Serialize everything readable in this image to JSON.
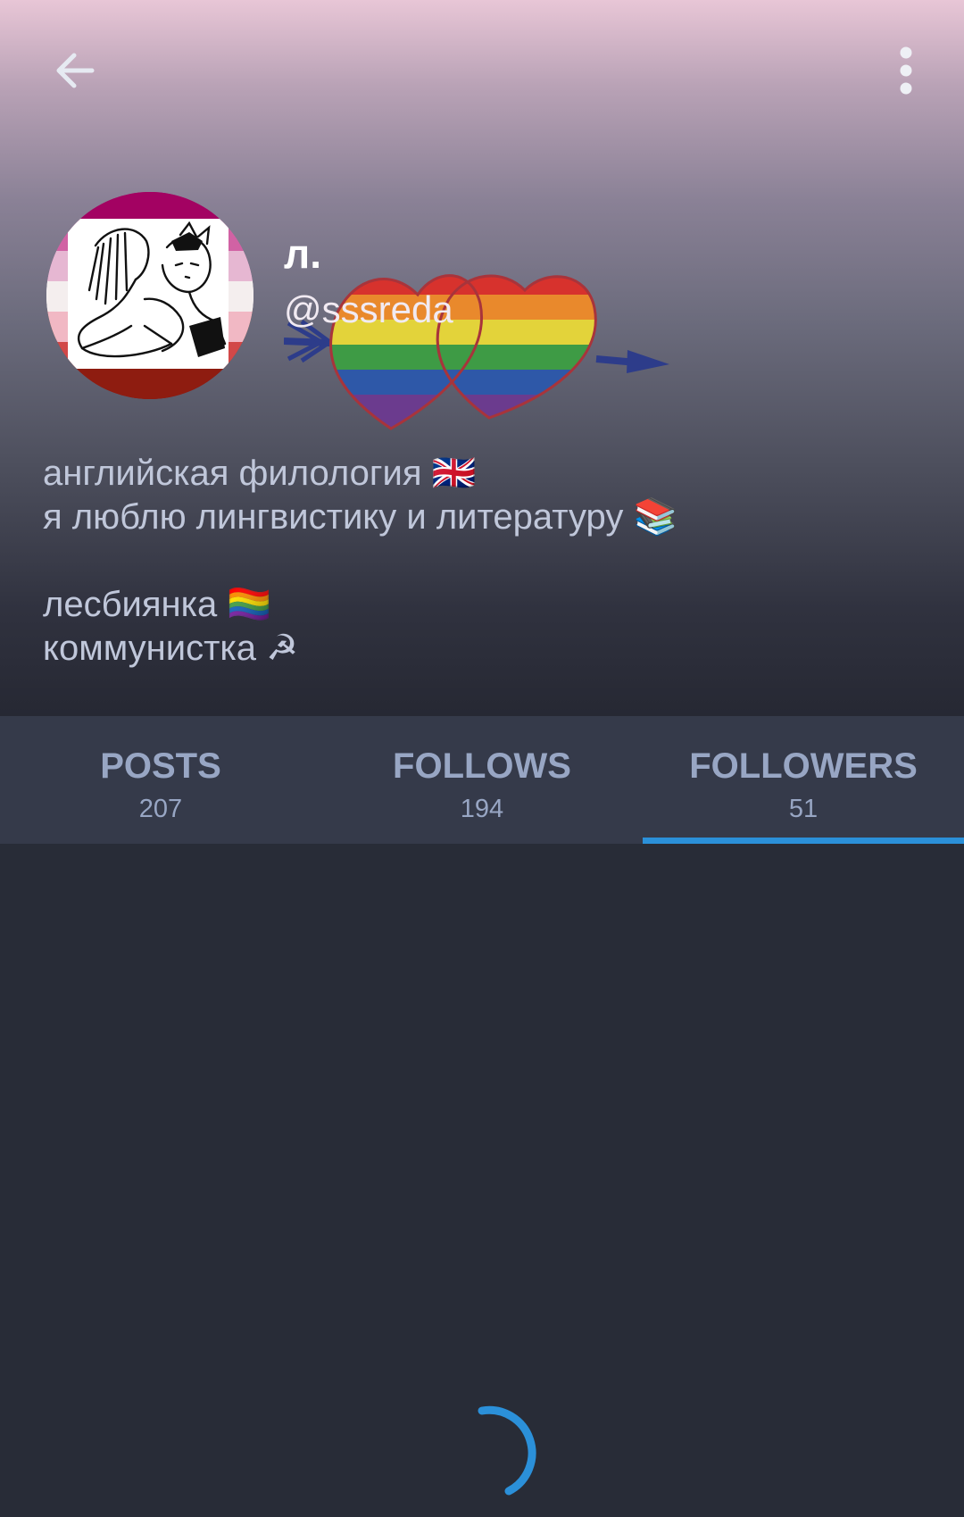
{
  "profile": {
    "display_name": "л.",
    "handle": "@sssreda",
    "bio_lines": [
      "английская филология 🇬🇧",
      "я люблю лингвистику и литературу 📚",
      "",
      "лесбиянка 🏳️‍🌈",
      "коммунистка ☭"
    ]
  },
  "toolbar": {
    "back_icon": "arrow-left-icon",
    "menu_icon": "more-vertical-icon"
  },
  "tabs": [
    {
      "label": "POSTS",
      "count": "207",
      "active": false
    },
    {
      "label": "FOLLOWS",
      "count": "194",
      "active": false
    },
    {
      "label": "FOLLOWERS",
      "count": "51",
      "active": true
    }
  ],
  "colors": {
    "accent": "#2b90d9",
    "tab_bar": "#353a4a",
    "background": "#282c37",
    "tab_text": "#98a6c4",
    "bio_text": "#c0c7da"
  },
  "loading": true
}
